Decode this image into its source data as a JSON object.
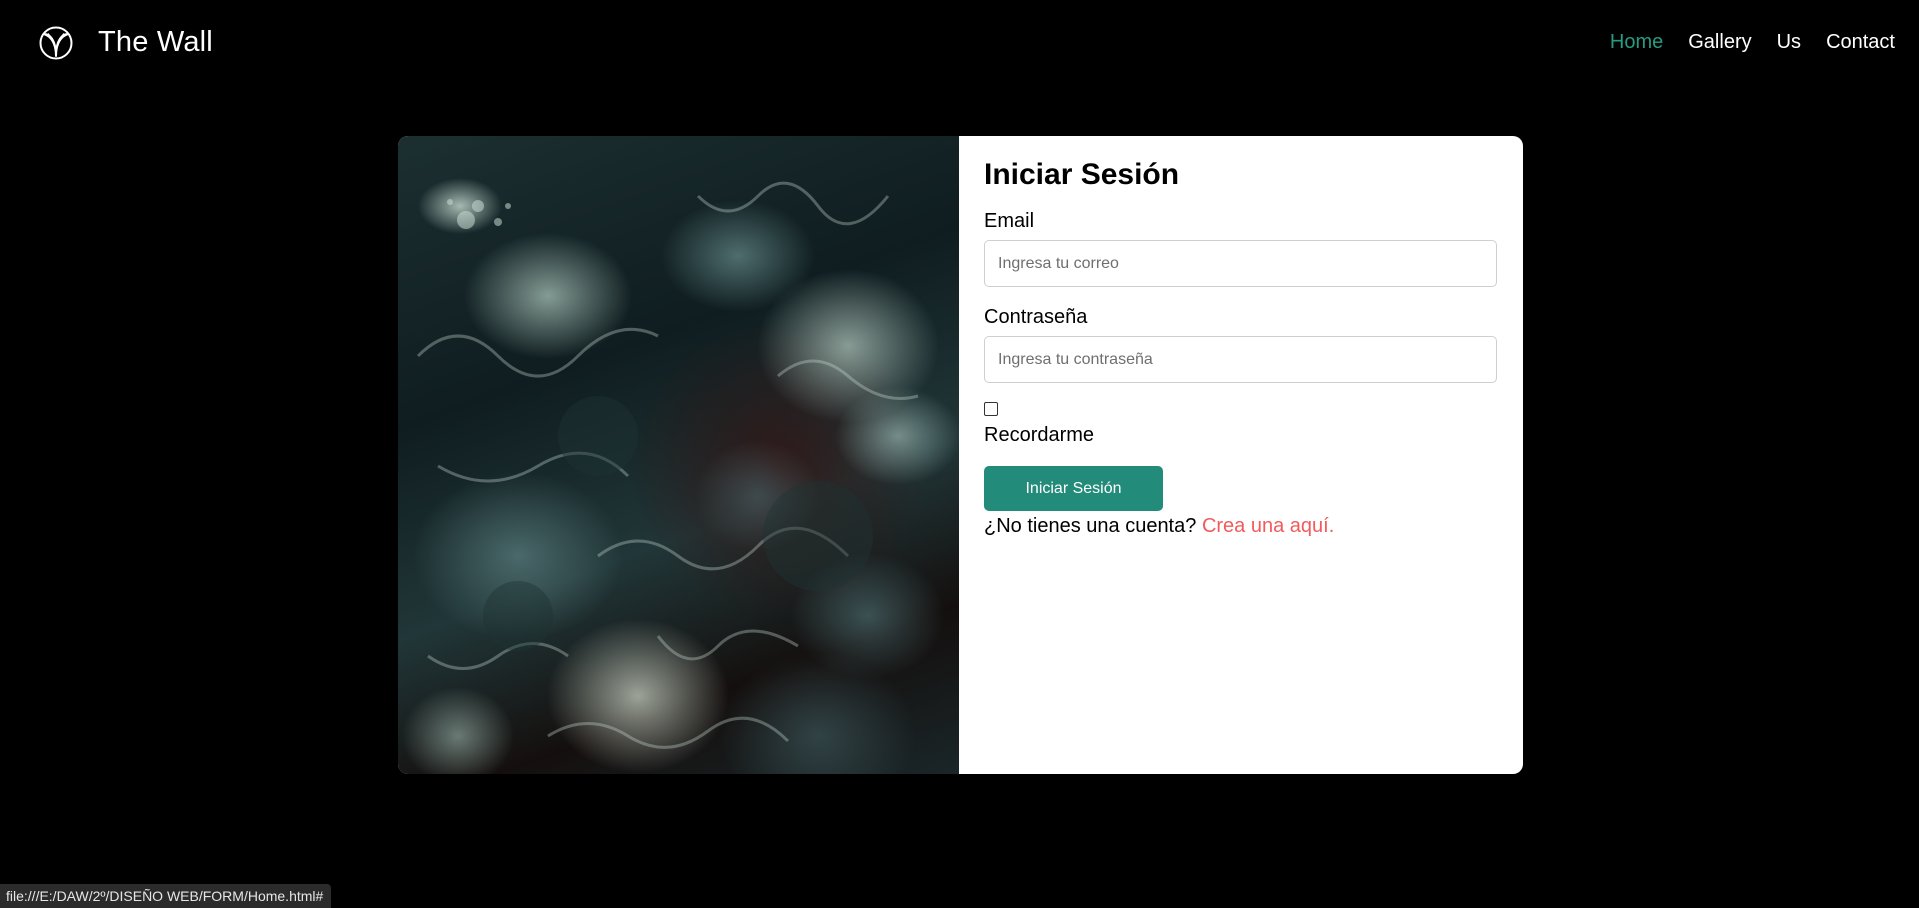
{
  "colors": {
    "background": "#000000",
    "accent": "#279b82",
    "button": "#238b7a",
    "link": "#f25b5b"
  },
  "navbar": {
    "brand_icon": "leaf-circle-logo-icon",
    "brand_name": "The Wall",
    "links": [
      {
        "label": "Home",
        "active": true
      },
      {
        "label": "Gallery",
        "active": false
      },
      {
        "label": "Us",
        "active": false
      },
      {
        "label": "Contact",
        "active": false
      }
    ]
  },
  "login": {
    "title": "Iniciar Sesión",
    "email_label": "Email",
    "email_placeholder": "Ingresa tu correo",
    "email_value": "",
    "password_label": "Contraseña",
    "password_placeholder": "Ingresa tu contraseña",
    "password_value": "",
    "remember_label": "Recordarme",
    "remember_checked": false,
    "submit_label": "Iniciar Sesión",
    "signup_prompt": "¿No tienes una cuenta?",
    "signup_link": "Crea una aquí."
  },
  "status_bar": {
    "url": "file:///E:/DAW/2º/DISEÑO WEB/FORM/Home.html#"
  }
}
